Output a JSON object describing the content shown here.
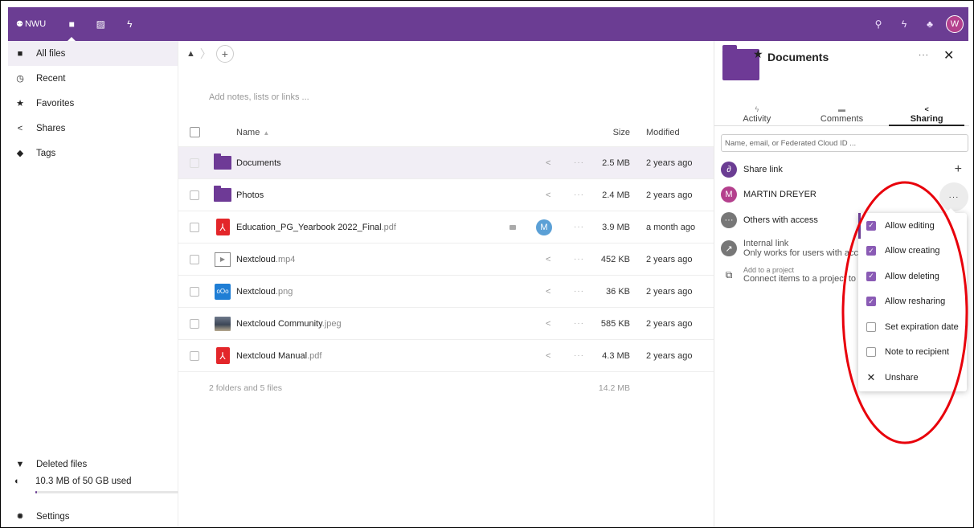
{
  "header": {
    "logo_text": "NWU",
    "apps": [
      {
        "name": "files-icon",
        "glyph": "■"
      },
      {
        "name": "photos-icon",
        "glyph": "▨"
      },
      {
        "name": "activity-icon",
        "glyph": "ϟ"
      }
    ],
    "right_icons": [
      {
        "name": "search-icon",
        "glyph": "⚲"
      },
      {
        "name": "notifications-icon",
        "glyph": "ϟ"
      },
      {
        "name": "contacts-icon",
        "glyph": "♣"
      }
    ],
    "avatar_letter": "W",
    "bg_color": "#6b3d93"
  },
  "sidebar": {
    "items": [
      {
        "label": "All files",
        "icon": "folder-icon",
        "glyph": "■"
      },
      {
        "label": "Recent",
        "icon": "clock-icon",
        "glyph": "◷"
      },
      {
        "label": "Favorites",
        "icon": "star-icon",
        "glyph": "★"
      },
      {
        "label": "Shares",
        "icon": "share-icon",
        "glyph": "<"
      },
      {
        "label": "Tags",
        "icon": "tag-icon",
        "glyph": "◆"
      }
    ],
    "deleted_files": "Deleted files",
    "quota": "10.3 MB of 50 GB used",
    "settings": "Settings"
  },
  "main": {
    "notes_placeholder": "Add notes, lists or links ...",
    "columns": {
      "name": "Name",
      "size": "Size",
      "modified": "Modified"
    },
    "files": [
      {
        "name": "Documents",
        "ext": "",
        "type": "folder",
        "size": "2.5 MB",
        "modified": "2 years ago",
        "selected": true
      },
      {
        "name": "Photos",
        "ext": "",
        "type": "folder",
        "size": "2.4 MB",
        "modified": "2 years ago"
      },
      {
        "name": "Education_PG_Yearbook 2022_Final",
        "ext": ".pdf",
        "type": "pdf",
        "size": "3.9 MB",
        "modified": "a month ago",
        "shared_with": "M"
      },
      {
        "name": "Nextcloud",
        "ext": ".mp4",
        "type": "video",
        "size": "452 KB",
        "modified": "2 years ago"
      },
      {
        "name": "Nextcloud",
        "ext": ".png",
        "type": "png",
        "size": "36 KB",
        "modified": "2 years ago"
      },
      {
        "name": "Nextcloud Community",
        "ext": ".jpeg",
        "type": "jpeg",
        "size": "585 KB",
        "modified": "2 years ago"
      },
      {
        "name": "Nextcloud Manual",
        "ext": ".pdf",
        "type": "pdf",
        "size": "4.3 MB",
        "modified": "2 years ago"
      }
    ],
    "summary": "2 folders and 5 files",
    "summary_size": "14.2 MB"
  },
  "details": {
    "title": "Documents",
    "tabs": [
      {
        "label": "Activity",
        "glyph": "ϟ"
      },
      {
        "label": "Comments",
        "glyph": "▬"
      },
      {
        "label": "Sharing",
        "glyph": "<",
        "active": true
      }
    ],
    "sharee_placeholder": "Name, email, or Federated Cloud ID ...",
    "share_link": "Share link",
    "sharee_name": "MARTIN DREYER",
    "sharee_initial": "M",
    "others_with_access": "Others with access",
    "internal_link": "Internal link",
    "internal_link_sub": "Only works for users with acc",
    "add_project_small": "Add to a project",
    "add_project": "Connect items to a project to"
  },
  "menu": {
    "items": [
      {
        "label": "Allow editing",
        "checked": true
      },
      {
        "label": "Allow creating",
        "checked": true
      },
      {
        "label": "Allow deleting",
        "checked": true
      },
      {
        "label": "Allow resharing",
        "checked": true
      },
      {
        "label": "Set expiration date",
        "checked": false
      },
      {
        "label": "Note to recipient",
        "checked": false
      }
    ],
    "unshare": "Unshare"
  },
  "annotation": {
    "color": "#e8000b"
  }
}
